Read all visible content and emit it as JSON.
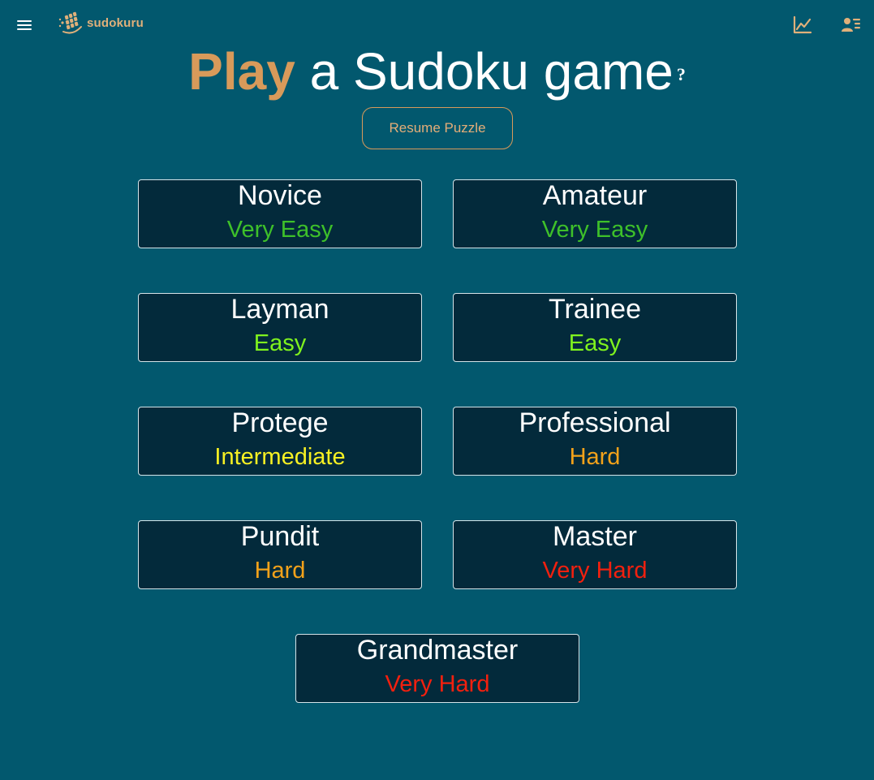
{
  "header": {
    "logo_text": "sudokuru",
    "icons": {
      "menu": "hamburger-menu-icon",
      "logo": "sudokuru-logo-icon",
      "stats": "line-chart-icon",
      "profile": "user-list-icon"
    }
  },
  "title": {
    "accent": "Play",
    "rest": " a Sudoku game",
    "help": "?"
  },
  "resume": {
    "label": "Resume Puzzle"
  },
  "levels": [
    {
      "name": "Novice",
      "difficulty": "Very Easy",
      "color": "#3ec02a"
    },
    {
      "name": "Amateur",
      "difficulty": "Very Easy",
      "color": "#3ec02a"
    },
    {
      "name": "Layman",
      "difficulty": "Easy",
      "color": "#7ff21e"
    },
    {
      "name": "Trainee",
      "difficulty": "Easy",
      "color": "#7ff21e"
    },
    {
      "name": "Protege",
      "difficulty": "Intermediate",
      "color": "#f6f023"
    },
    {
      "name": "Professional",
      "difficulty": "Hard",
      "color": "#f3a21a"
    },
    {
      "name": "Pundit",
      "difficulty": "Hard",
      "color": "#f3a21a"
    },
    {
      "name": "Master",
      "difficulty": "Very Hard",
      "color": "#f2200f"
    },
    {
      "name": "Grandmaster",
      "difficulty": "Very Hard",
      "color": "#f2200f"
    }
  ],
  "colors": {
    "background": "#02586e",
    "card": "#032a3b",
    "accent": "#d89a5a"
  }
}
